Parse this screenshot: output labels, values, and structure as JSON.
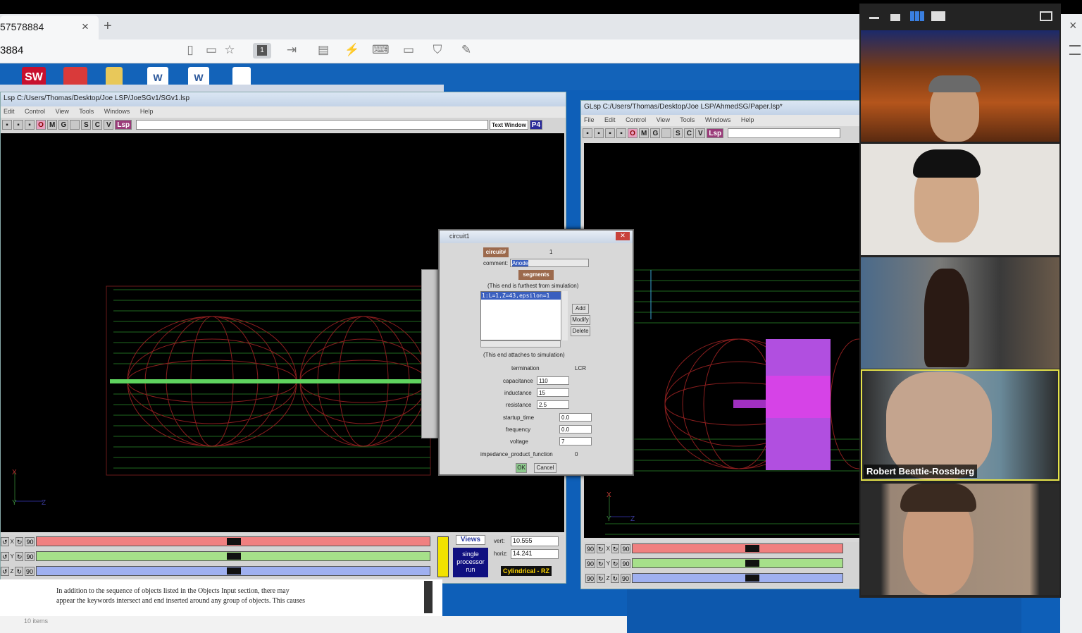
{
  "browser": {
    "tab_title": "57578884",
    "tab_close": "×",
    "new_tab": "+",
    "url": "3884",
    "close_window": "×"
  },
  "glsp_left": {
    "title": "Lsp  C:/Users/Thomas/Desktop/Joe LSP/JoeSGv1/SGv1.lsp",
    "menu": [
      "Edit",
      "Control",
      "View",
      "Tools",
      "Windows",
      "Help"
    ],
    "tools": [
      "O",
      "M",
      "G",
      "",
      "S",
      "C",
      "V",
      "Lsp"
    ],
    "text_window": "Text Window",
    "p4": "P4",
    "axis_x": "X",
    "axis_y": "Y",
    "axis_z": "Z",
    "slider_rows": [
      {
        "axis": "X",
        "value": "90"
      },
      {
        "axis": "Y",
        "value": "90"
      },
      {
        "axis": "Z",
        "value": "90"
      }
    ],
    "views_label": "Views",
    "run_mode": "single processor run",
    "vert_label": "vert:",
    "vert_value": "10.555",
    "horiz_label": "horiz:",
    "horiz_value": "14.241",
    "geometry": "Cylindrical - RZ"
  },
  "glsp_right": {
    "title": "GLsp  C:/Users/Thomas/Desktop/Joe LSP/AhmedSG/Paper.lsp*",
    "menu": [
      "File",
      "Edit",
      "Control",
      "View",
      "Tools",
      "Windows",
      "Help"
    ],
    "tools": [
      "O",
      "M",
      "G",
      "",
      "S",
      "C",
      "V",
      "Lsp"
    ],
    "axis_x": "X",
    "axis_y": "Y",
    "axis_z": "Z",
    "slider_rows": [
      {
        "left": "90",
        "axis": "X",
        "value": "90"
      },
      {
        "left": "90",
        "axis": "Y",
        "value": "90"
      },
      {
        "left": "90",
        "axis": "Z",
        "value": "90"
      }
    ]
  },
  "dialog": {
    "title": "circuit1",
    "circuit_label": "circuit#",
    "circuit_value": "1",
    "comment_label": "comment:",
    "comment_value": "Anode",
    "segments_label": "segments",
    "furthest_note": "(This end is furthest from simulation)",
    "segment_item": "1:L=1,Z=43,epsilon=1",
    "add": "Add",
    "modify": "Modify",
    "delete": "Delete",
    "attaches_note": "(This end attaches to simulation)",
    "termination_label": "termination",
    "termination_value": "LCR",
    "capacitance_label": "capacitance",
    "capacitance_value": "110",
    "inductance_label": "inductance",
    "inductance_value": "15",
    "resistance_label": "resistance",
    "resistance_value": "2.5",
    "startup_label": "startup_time",
    "startup_value": "0.0",
    "frequency_label": "frequency",
    "frequency_value": "0.0",
    "voltage_label": "voltage",
    "voltage_value": "7",
    "impedance_label": "impedance_product_function",
    "impedance_value": "0",
    "ok": "OK",
    "cancel": "Cancel"
  },
  "document": {
    "line1": "In addition to the sequence of objects listed in the Objects Input section, there may",
    "line2": "appear the keywords intersect and end inserted around any group of objects. This causes",
    "items": "10 items"
  },
  "video": {
    "participant_4_name": "Robert Beattie-Rossberg"
  },
  "colors": {
    "desktop_blue": "#0e5fb8",
    "slider_red": "#f08080",
    "slider_green": "#a6e08a",
    "slider_blue": "#9fb0f0",
    "active_speaker": "#e6e34a",
    "geometry_label": "#ffd700"
  }
}
